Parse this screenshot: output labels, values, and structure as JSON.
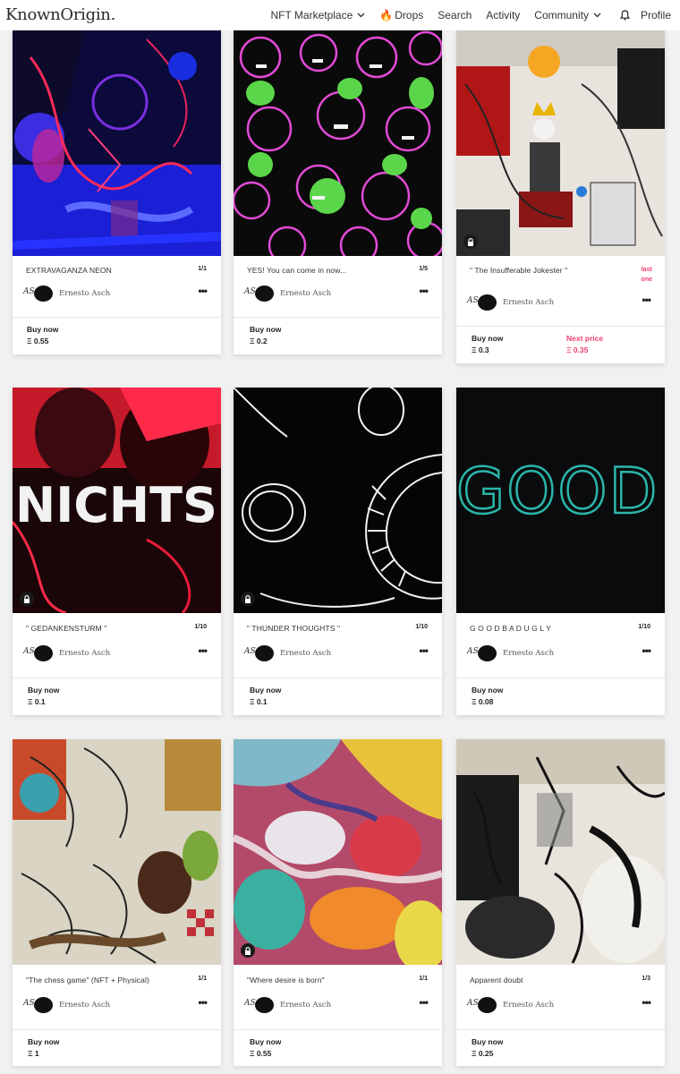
{
  "header": {
    "logo": "KnownOrigin.",
    "nav": {
      "marketplace": "NFT Marketplace",
      "drops": "Drops",
      "search": "Search",
      "activity": "Activity",
      "community": "Community",
      "profile": "Profile"
    }
  },
  "cards": [
    {
      "title": "EXTRAVAGANZA NEON",
      "edition": "1/1",
      "artist": "Ernesto Asch",
      "buy_label": "Buy now",
      "price": "Ξ 0.55"
    },
    {
      "title": "YES! You can come in now...",
      "edition": "1/5",
      "artist": "Ernesto Asch",
      "buy_label": "Buy now",
      "price": "Ξ 0.2"
    },
    {
      "title": "\" The Insufferable Jokester \"",
      "edition_line1": "last",
      "edition_line2": "one",
      "artist": "Ernesto Asch",
      "buy_label": "Buy now",
      "price": "Ξ 0.3",
      "next_label": "Next price",
      "next_price": "Ξ 0.35"
    },
    {
      "title": "\" GEDANKENSTURM \"",
      "edition": "1/10",
      "artist": "Ernesto Asch",
      "buy_label": "Buy now",
      "price": "Ξ 0.1"
    },
    {
      "title": "\" THUNDER THOUGHTS \"",
      "edition": "1/10",
      "artist": "Ernesto Asch",
      "buy_label": "Buy now",
      "price": "Ξ 0.1"
    },
    {
      "title": "G O O D B A D U G L Y",
      "edition": "1/10",
      "artist": "Ernesto Asch",
      "buy_label": "Buy now",
      "price": "Ξ 0.08"
    },
    {
      "title": "\"The chess game\" (NFT + Physical)",
      "edition": "1/1",
      "artist": "Ernesto Asch",
      "buy_label": "Buy now",
      "price": "Ξ 1"
    },
    {
      "title": "\"Where desire is born\"",
      "edition": "1/1",
      "artist": "Ernesto Asch",
      "buy_label": "Buy now",
      "price": "Ξ 0.55"
    },
    {
      "title": "Apparent doubt",
      "edition": "1/3",
      "artist": "Ernesto Asch",
      "buy_label": "Buy now",
      "price": "Ξ 0.25"
    }
  ],
  "artwork_text": {
    "nichts": "NICHTS",
    "good": "GOOD"
  },
  "colors": {
    "accent_pink": "#f13f6c",
    "background": "#f1f1f1"
  },
  "icons": {
    "dropdown": "chevron-down-icon",
    "drops": "fire-icon",
    "notifications": "bell-icon",
    "locked": "lock-icon",
    "more": "ellipsis-icon"
  }
}
